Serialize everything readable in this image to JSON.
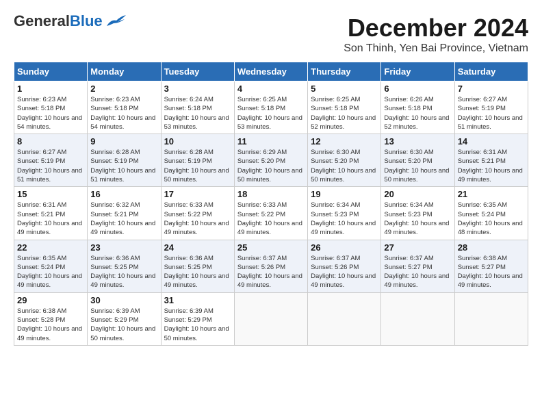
{
  "header": {
    "logo_general": "General",
    "logo_blue": "Blue",
    "month_title": "December 2024",
    "location": "Son Thinh, Yen Bai Province, Vietnam"
  },
  "weekdays": [
    "Sunday",
    "Monday",
    "Tuesday",
    "Wednesday",
    "Thursday",
    "Friday",
    "Saturday"
  ],
  "weeks": [
    [
      {
        "day": "1",
        "sunrise": "Sunrise: 6:23 AM",
        "sunset": "Sunset: 5:18 PM",
        "daylight": "Daylight: 10 hours and 54 minutes."
      },
      {
        "day": "2",
        "sunrise": "Sunrise: 6:23 AM",
        "sunset": "Sunset: 5:18 PM",
        "daylight": "Daylight: 10 hours and 54 minutes."
      },
      {
        "day": "3",
        "sunrise": "Sunrise: 6:24 AM",
        "sunset": "Sunset: 5:18 PM",
        "daylight": "Daylight: 10 hours and 53 minutes."
      },
      {
        "day": "4",
        "sunrise": "Sunrise: 6:25 AM",
        "sunset": "Sunset: 5:18 PM",
        "daylight": "Daylight: 10 hours and 53 minutes."
      },
      {
        "day": "5",
        "sunrise": "Sunrise: 6:25 AM",
        "sunset": "Sunset: 5:18 PM",
        "daylight": "Daylight: 10 hours and 52 minutes."
      },
      {
        "day": "6",
        "sunrise": "Sunrise: 6:26 AM",
        "sunset": "Sunset: 5:18 PM",
        "daylight": "Daylight: 10 hours and 52 minutes."
      },
      {
        "day": "7",
        "sunrise": "Sunrise: 6:27 AM",
        "sunset": "Sunset: 5:19 PM",
        "daylight": "Daylight: 10 hours and 51 minutes."
      }
    ],
    [
      {
        "day": "8",
        "sunrise": "Sunrise: 6:27 AM",
        "sunset": "Sunset: 5:19 PM",
        "daylight": "Daylight: 10 hours and 51 minutes."
      },
      {
        "day": "9",
        "sunrise": "Sunrise: 6:28 AM",
        "sunset": "Sunset: 5:19 PM",
        "daylight": "Daylight: 10 hours and 51 minutes."
      },
      {
        "day": "10",
        "sunrise": "Sunrise: 6:28 AM",
        "sunset": "Sunset: 5:19 PM",
        "daylight": "Daylight: 10 hours and 50 minutes."
      },
      {
        "day": "11",
        "sunrise": "Sunrise: 6:29 AM",
        "sunset": "Sunset: 5:20 PM",
        "daylight": "Daylight: 10 hours and 50 minutes."
      },
      {
        "day": "12",
        "sunrise": "Sunrise: 6:30 AM",
        "sunset": "Sunset: 5:20 PM",
        "daylight": "Daylight: 10 hours and 50 minutes."
      },
      {
        "day": "13",
        "sunrise": "Sunrise: 6:30 AM",
        "sunset": "Sunset: 5:20 PM",
        "daylight": "Daylight: 10 hours and 50 minutes."
      },
      {
        "day": "14",
        "sunrise": "Sunrise: 6:31 AM",
        "sunset": "Sunset: 5:21 PM",
        "daylight": "Daylight: 10 hours and 49 minutes."
      }
    ],
    [
      {
        "day": "15",
        "sunrise": "Sunrise: 6:31 AM",
        "sunset": "Sunset: 5:21 PM",
        "daylight": "Daylight: 10 hours and 49 minutes."
      },
      {
        "day": "16",
        "sunrise": "Sunrise: 6:32 AM",
        "sunset": "Sunset: 5:21 PM",
        "daylight": "Daylight: 10 hours and 49 minutes."
      },
      {
        "day": "17",
        "sunrise": "Sunrise: 6:33 AM",
        "sunset": "Sunset: 5:22 PM",
        "daylight": "Daylight: 10 hours and 49 minutes."
      },
      {
        "day": "18",
        "sunrise": "Sunrise: 6:33 AM",
        "sunset": "Sunset: 5:22 PM",
        "daylight": "Daylight: 10 hours and 49 minutes."
      },
      {
        "day": "19",
        "sunrise": "Sunrise: 6:34 AM",
        "sunset": "Sunset: 5:23 PM",
        "daylight": "Daylight: 10 hours and 49 minutes."
      },
      {
        "day": "20",
        "sunrise": "Sunrise: 6:34 AM",
        "sunset": "Sunset: 5:23 PM",
        "daylight": "Daylight: 10 hours and 49 minutes."
      },
      {
        "day": "21",
        "sunrise": "Sunrise: 6:35 AM",
        "sunset": "Sunset: 5:24 PM",
        "daylight": "Daylight: 10 hours and 48 minutes."
      }
    ],
    [
      {
        "day": "22",
        "sunrise": "Sunrise: 6:35 AM",
        "sunset": "Sunset: 5:24 PM",
        "daylight": "Daylight: 10 hours and 49 minutes."
      },
      {
        "day": "23",
        "sunrise": "Sunrise: 6:36 AM",
        "sunset": "Sunset: 5:25 PM",
        "daylight": "Daylight: 10 hours and 49 minutes."
      },
      {
        "day": "24",
        "sunrise": "Sunrise: 6:36 AM",
        "sunset": "Sunset: 5:25 PM",
        "daylight": "Daylight: 10 hours and 49 minutes."
      },
      {
        "day": "25",
        "sunrise": "Sunrise: 6:37 AM",
        "sunset": "Sunset: 5:26 PM",
        "daylight": "Daylight: 10 hours and 49 minutes."
      },
      {
        "day": "26",
        "sunrise": "Sunrise: 6:37 AM",
        "sunset": "Sunset: 5:26 PM",
        "daylight": "Daylight: 10 hours and 49 minutes."
      },
      {
        "day": "27",
        "sunrise": "Sunrise: 6:37 AM",
        "sunset": "Sunset: 5:27 PM",
        "daylight": "Daylight: 10 hours and 49 minutes."
      },
      {
        "day": "28",
        "sunrise": "Sunrise: 6:38 AM",
        "sunset": "Sunset: 5:27 PM",
        "daylight": "Daylight: 10 hours and 49 minutes."
      }
    ],
    [
      {
        "day": "29",
        "sunrise": "Sunrise: 6:38 AM",
        "sunset": "Sunset: 5:28 PM",
        "daylight": "Daylight: 10 hours and 49 minutes."
      },
      {
        "day": "30",
        "sunrise": "Sunrise: 6:39 AM",
        "sunset": "Sunset: 5:29 PM",
        "daylight": "Daylight: 10 hours and 50 minutes."
      },
      {
        "day": "31",
        "sunrise": "Sunrise: 6:39 AM",
        "sunset": "Sunset: 5:29 PM",
        "daylight": "Daylight: 10 hours and 50 minutes."
      },
      null,
      null,
      null,
      null
    ]
  ]
}
